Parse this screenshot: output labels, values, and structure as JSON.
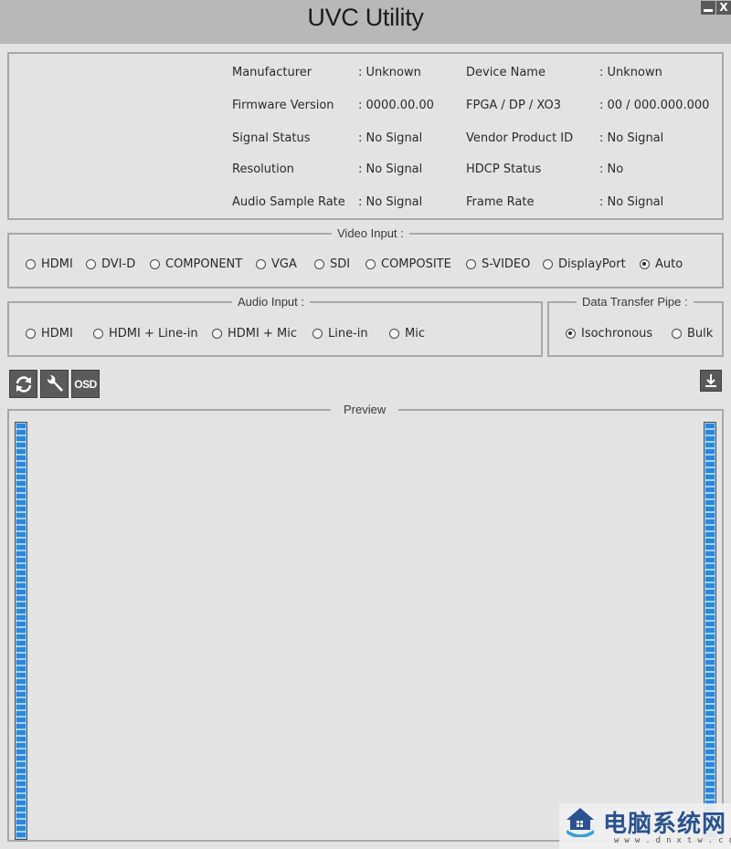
{
  "window": {
    "title": "UVC Utility",
    "minimize_label": "_",
    "close_label": "X"
  },
  "info": {
    "left": [
      {
        "label": "Manufacturer",
        "value": ": Unknown"
      },
      {
        "label": "Firmware Version",
        "value": ": 0000.00.00"
      },
      {
        "label": "Signal Status",
        "value": ": No Signal"
      },
      {
        "label": "Resolution",
        "value": ": No Signal"
      },
      {
        "label": "Audio Sample Rate",
        "value": ": No Signal"
      }
    ],
    "right": [
      {
        "label": "Device Name",
        "value": ": Unknown"
      },
      {
        "label": "FPGA / DP / XO3",
        "value": ": 00 / 000.000.000"
      },
      {
        "label": "Vendor  Product ID",
        "value": ": No Signal"
      },
      {
        "label": "HDCP Status",
        "value": ": No"
      },
      {
        "label": "Frame Rate",
        "value": ": No Signal"
      }
    ]
  },
  "video_input": {
    "title": "Video Input :",
    "selected": "Auto",
    "options": [
      "HDMI",
      "DVI-D",
      "COMPONENT",
      "VGA",
      "SDI",
      "COMPOSITE",
      "S-VIDEO",
      "DisplayPort",
      "Auto"
    ]
  },
  "audio_input": {
    "title": "Audio Input :",
    "selected": null,
    "options": [
      "HDMI",
      "HDMI + Line-in",
      "HDMI + Mic",
      "Line-in",
      "Mic"
    ]
  },
  "data_transfer": {
    "title": "Data Transfer Pipe :",
    "selected": "Isochronous",
    "options": [
      "Isochronous",
      "Bulk"
    ]
  },
  "toolbar": {
    "refresh_icon": "refresh-icon",
    "settings_icon": "wrench-icon",
    "osd_label": "OSD",
    "download_icon": "download-icon"
  },
  "preview": {
    "title": "Preview",
    "left_meter_level": 1.0,
    "right_meter_level": 1.0,
    "meter_color": "#2b86e0"
  },
  "watermark": {
    "text": "电脑系统网",
    "url": "www.dnxtw.com"
  }
}
